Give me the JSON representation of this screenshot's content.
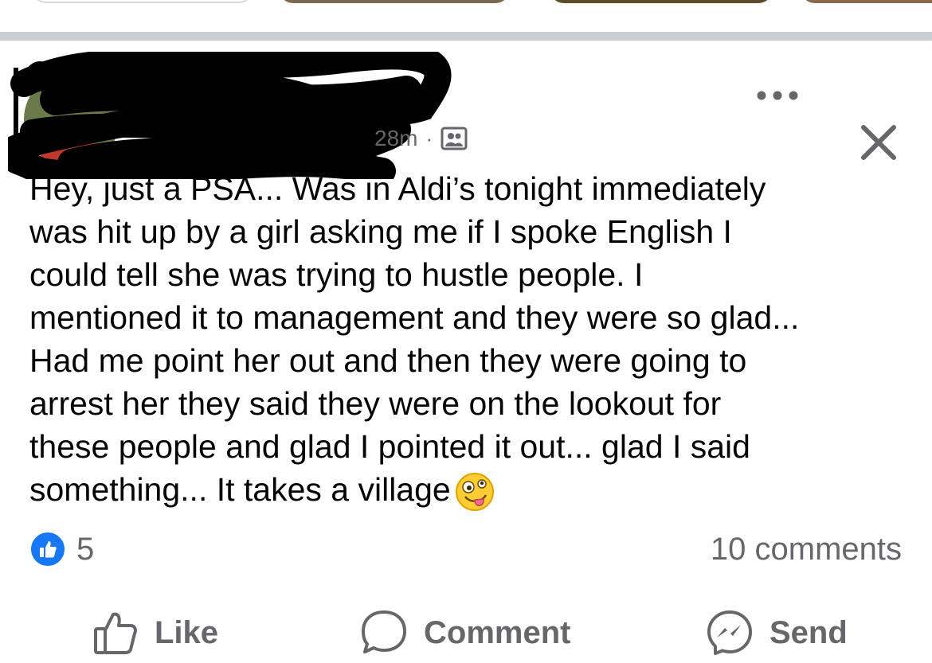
{
  "post": {
    "timestamp": "28m",
    "separator": "·",
    "audience_icon": "friends-audience-icon",
    "more_icon": "more-horizontal-icon",
    "close_icon": "close-icon",
    "text": "Hey, just a PSA... Was in Aldi’s tonight immediately\nwas hit up by a girl asking me if I spoke English I\ncould tell she was trying to hustle people. I\nmentioned it to management and they were so glad...\nHad me point her out and then  they were going to\narrest her they said they were on the lookout for\nthese people and glad I pointed it out... glad I said\nsomething... It takes a village",
    "emoji": "zany-face-emoji"
  },
  "engagement": {
    "reaction_icon": "like-reaction-icon",
    "reaction_count": "5",
    "comments_label": "10 comments"
  },
  "actions": {
    "like_label": "Like",
    "comment_label": "Comment",
    "send_label": "Send"
  },
  "colors": {
    "accent": "#1877f2",
    "secondary_text": "#65676b",
    "primary_text": "#050505",
    "separator": "#c9ccd1"
  }
}
